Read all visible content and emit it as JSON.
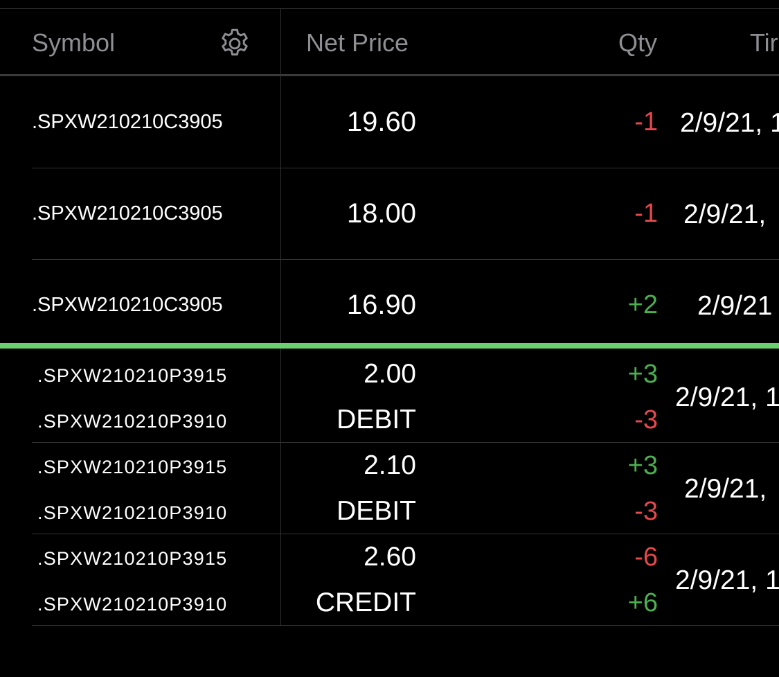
{
  "header": {
    "symbol_label": "Symbol",
    "net_price_label": "Net Price",
    "qty_label": "Qty",
    "time_label": "Tir"
  },
  "rows": [
    {
      "symbol": ".SPXW210210C3905",
      "price": "19.60",
      "qty": "-1",
      "time": "2/9/21, 1"
    },
    {
      "symbol": ".SPXW210210C3905",
      "price": "18.00",
      "qty": "-1",
      "time": "2/9/21,"
    },
    {
      "symbol": ".SPXW210210C3905",
      "price": "16.90",
      "qty": "+2",
      "time": "2/9/21"
    }
  ],
  "spreads": [
    {
      "legs": [
        {
          "symbol": ".SPXW210210P3915",
          "qty": "+3"
        },
        {
          "symbol": ".SPXW210210P3910",
          "qty": "-3"
        }
      ],
      "price": "2.00",
      "price_type": "DEBIT",
      "time": "2/9/21, 1"
    },
    {
      "legs": [
        {
          "symbol": ".SPXW210210P3915",
          "qty": "+3"
        },
        {
          "symbol": ".SPXW210210P3910",
          "qty": "-3"
        }
      ],
      "price": "2.10",
      "price_type": "DEBIT",
      "time": "2/9/21,"
    },
    {
      "legs": [
        {
          "symbol": ".SPXW210210P3915",
          "qty": "-6"
        },
        {
          "symbol": ".SPXW210210P3910",
          "qty": "+6"
        }
      ],
      "price": "2.60",
      "price_type": "CREDIT",
      "time": "2/9/21, 1"
    }
  ],
  "colors": {
    "background": "#000000",
    "header_text": "#8e8e93",
    "positive": "#4caf50",
    "negative": "#e5484d",
    "divider_accent": "#6bd06f",
    "grid_line": "#333333"
  },
  "icons": {
    "settings": "gear-icon"
  }
}
